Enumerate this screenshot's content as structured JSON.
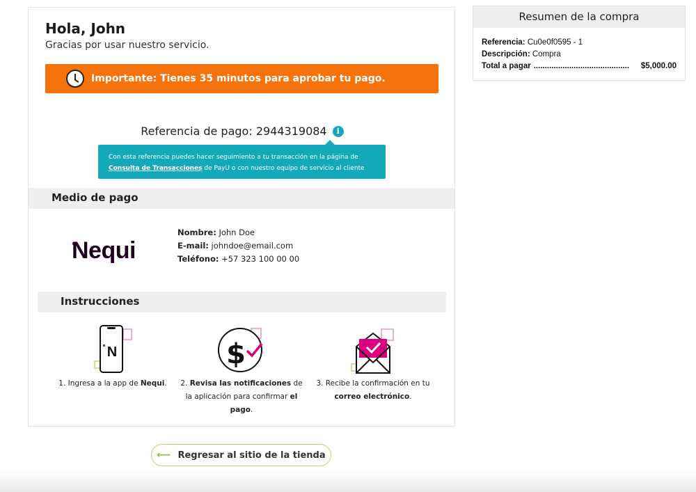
{
  "header": {
    "greeting": "Hola, John",
    "thanks": "Gracias por usar nuestro servicio."
  },
  "alert": {
    "icon": "clock-icon",
    "text": "Importante: Tienes 35 minutos para aprobar tu pago.",
    "color": "#f5730a"
  },
  "reference": {
    "label": "Referencia de pago: 2944319084",
    "info_symbol": "i",
    "tooltip_line1": "Con esta referencia puedes hacer seguimiento a tu transacción en la página de",
    "tooltip_link": "Consulta de Transacciones",
    "tooltip_line2": " de PayU o con nuestro equipo de servicio al cliente",
    "tooltip_color": "#14a9b8"
  },
  "payment_method": {
    "title": "Medio de pago",
    "logo_text": "Nequi",
    "name_label": "Nombre:",
    "name_value": " John Doe",
    "email_label": "E-mail:",
    "email_value": " johndoe@email.com",
    "phone_label": "Teléfono:",
    "phone_value": " +57 323 100 00 00"
  },
  "instructions": {
    "title": "Instrucciones",
    "steps": [
      {
        "icon": "phone-icon",
        "pre": "1. Ingresa a la app de ",
        "bold": "Nequi",
        "post": "."
      },
      {
        "icon": "dollar-check-icon",
        "pre": "2. ",
        "bold": "Revisa las notificaciones",
        "mid": " de la aplicación para confirmar ",
        "bold2": "el pago",
        "post": "."
      },
      {
        "icon": "envelope-icon",
        "pre": "3. Recibe la confirmación en tu ",
        "bold": "correo electrónico",
        "post": "."
      }
    ]
  },
  "back_button": {
    "label": "Regresar al sitio de la tienda",
    "arrow": "⟵"
  },
  "summary": {
    "title": "Resumen de la compra",
    "reference_label": "Referencia:",
    "reference_value": " Cu0e0f0595 - 1",
    "description_label": "Descripción:",
    "description_value": " Compra",
    "total_label": "Total a pagar",
    "total_dots": "...........................................",
    "total_value": "$5,000.00"
  },
  "colors": {
    "accent_orange": "#f5730a",
    "accent_teal": "#14a9b8",
    "nequi_pink": "#da0081",
    "button_border": "#b7d86f"
  }
}
